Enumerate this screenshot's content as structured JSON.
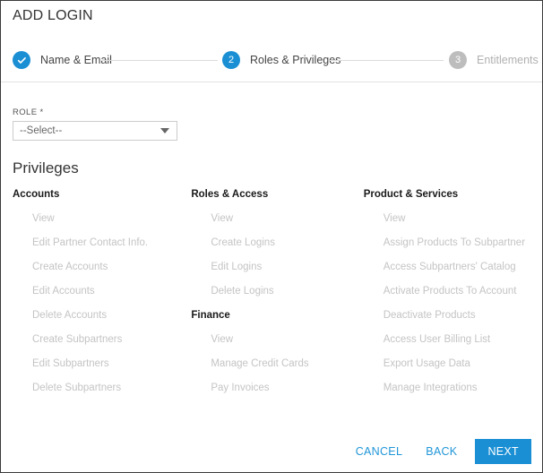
{
  "window": {
    "title": "ADD LOGIN"
  },
  "colors": {
    "accent": "#1a8fd4",
    "link": "#2196d8",
    "idle_step": "#bdbdbd",
    "muted_text": "#c4c4c4"
  },
  "stepper": {
    "steps": [
      {
        "number": "1",
        "label": "Name & Email",
        "state": "done",
        "icon": "check-icon"
      },
      {
        "number": "2",
        "label": "Roles & Privileges",
        "state": "active",
        "icon": ""
      },
      {
        "number": "3",
        "label": "Entitlements",
        "state": "idle",
        "icon": ""
      }
    ]
  },
  "role": {
    "label": "ROLE *",
    "selected": "--Select--",
    "caret_icon": "chevron-down-icon"
  },
  "privileges": {
    "heading": "Privileges",
    "columns": [
      {
        "groups": [
          {
            "header": "Accounts",
            "items": [
              "View",
              "Edit Partner Contact Info.",
              "Create Accounts",
              "Edit Accounts",
              "Delete Accounts",
              "Create Subpartners",
              "Edit Subpartners",
              "Delete Subpartners"
            ]
          }
        ]
      },
      {
        "groups": [
          {
            "header": "Roles & Access",
            "items": [
              "View",
              "Create Logins",
              "Edit Logins",
              "Delete Logins"
            ]
          },
          {
            "header": "Finance",
            "items": [
              "View",
              "Manage Credit Cards",
              "Pay Invoices"
            ]
          }
        ]
      },
      {
        "groups": [
          {
            "header": "Product & Services",
            "items": [
              "View",
              "Assign Products To Subpartner",
              "Access Subpartners' Catalog",
              "Activate Products To Account",
              "Deactivate Products",
              "Access User Billing List",
              "Export Usage Data",
              "Manage Integrations"
            ]
          }
        ]
      }
    ]
  },
  "footer": {
    "cancel_label": "CANCEL",
    "back_label": "BACK",
    "next_label": "NEXT"
  }
}
